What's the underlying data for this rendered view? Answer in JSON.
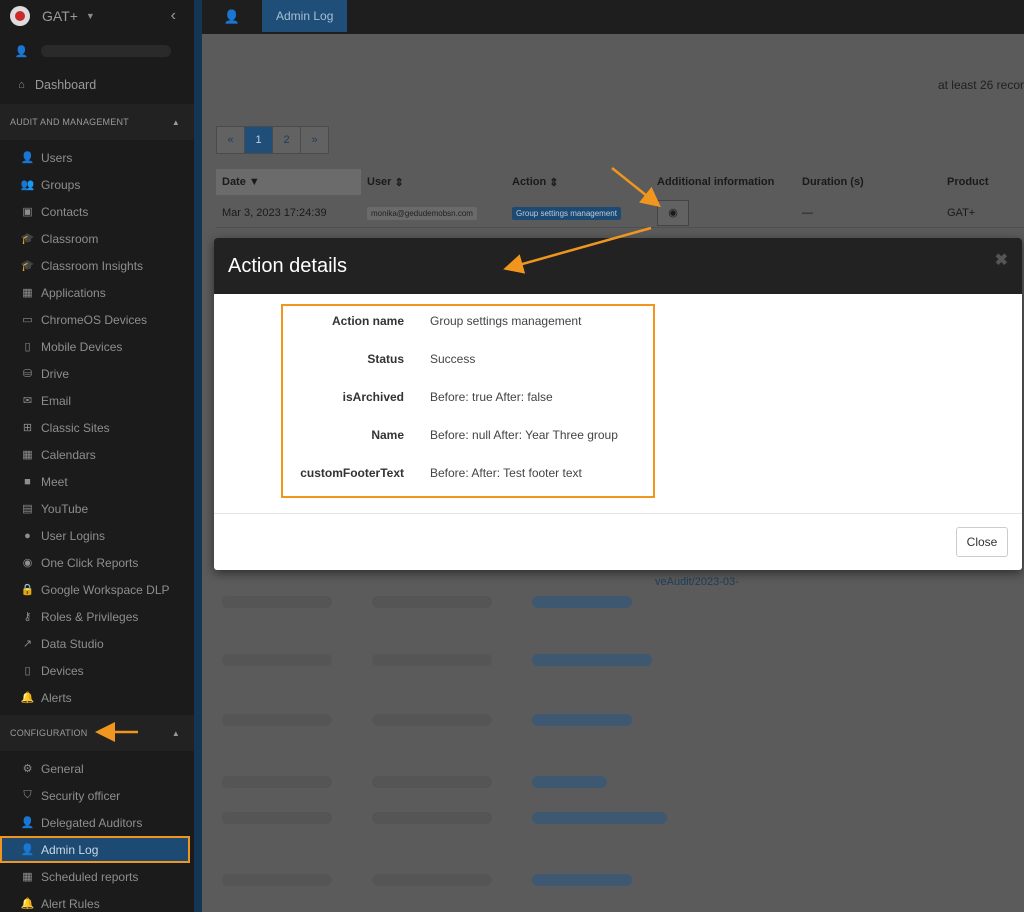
{
  "app": {
    "brand": "GAT+"
  },
  "sidebar": {
    "dashboard": "Dashboard",
    "section_audit": "AUDIT AND MANAGEMENT",
    "audit_items": [
      {
        "label": "Users",
        "icon": "user-icon",
        "glyph": "👤"
      },
      {
        "label": "Groups",
        "icon": "groups-icon",
        "glyph": "👥"
      },
      {
        "label": "Contacts",
        "icon": "contacts-icon",
        "glyph": "▣"
      },
      {
        "label": "Classroom",
        "icon": "classroom-icon",
        "glyph": "🎓"
      },
      {
        "label": "Classroom Insights",
        "icon": "classroom-insights-icon",
        "glyph": "🎓"
      },
      {
        "label": "Applications",
        "icon": "applications-icon",
        "glyph": "▦"
      },
      {
        "label": "ChromeOS Devices",
        "icon": "laptop-icon",
        "glyph": "▭"
      },
      {
        "label": "Mobile Devices",
        "icon": "mobile-icon",
        "glyph": "▯"
      },
      {
        "label": "Drive",
        "icon": "drive-icon",
        "glyph": "⛁"
      },
      {
        "label": "Email",
        "icon": "email-icon",
        "glyph": "✉"
      },
      {
        "label": "Classic Sites",
        "icon": "sitemap-icon",
        "glyph": "⊞"
      },
      {
        "label": "Calendars",
        "icon": "calendar-icon",
        "glyph": "▦"
      },
      {
        "label": "Meet",
        "icon": "video-icon",
        "glyph": "■"
      },
      {
        "label": "YouTube",
        "icon": "film-icon",
        "glyph": "▤"
      },
      {
        "label": "User Logins",
        "icon": "globe-icon",
        "glyph": "●"
      },
      {
        "label": "One Click Reports",
        "icon": "eye-icon",
        "glyph": "◉"
      },
      {
        "label": "Google Workspace DLP",
        "icon": "lock-icon",
        "glyph": "🔒"
      },
      {
        "label": "Roles & Privileges",
        "icon": "key-icon",
        "glyph": "⚷"
      },
      {
        "label": "Data Studio",
        "icon": "line-chart-icon",
        "glyph": "↗"
      },
      {
        "label": "Devices",
        "icon": "devices-icon",
        "glyph": "▯"
      },
      {
        "label": "Alerts",
        "icon": "bell-icon",
        "glyph": "🔔"
      }
    ],
    "section_config": "CONFIGURATION",
    "config_items": [
      {
        "label": "General",
        "icon": "gears-icon",
        "glyph": "⚙"
      },
      {
        "label": "Security officer",
        "icon": "shield-icon",
        "glyph": "⛉"
      },
      {
        "label": "Delegated Auditors",
        "icon": "user-share-icon",
        "glyph": "👤"
      },
      {
        "label": "Admin Log",
        "icon": "user-star-icon",
        "glyph": "👤",
        "active": true
      },
      {
        "label": "Scheduled reports",
        "icon": "calendar-icon",
        "glyph": "▦"
      },
      {
        "label": "Alert Rules",
        "icon": "bell-icon",
        "glyph": "🔔"
      }
    ]
  },
  "topbar": {
    "tab": "Admin Log"
  },
  "main": {
    "records": "at least 26 recor",
    "pager": [
      "«",
      "1",
      "2",
      "»"
    ],
    "pager_active": "1",
    "columns": [
      "Date",
      "User",
      "Action",
      "Additional information",
      "Duration (s)",
      "Product"
    ],
    "sort_indicators": {
      "date": "▼",
      "user": "⇕",
      "action": "⇕"
    },
    "row": {
      "date": "Mar 3, 2023 17:24:39",
      "user": "monika@gedudemobsn.com",
      "action": "Group settings management",
      "duration": "—",
      "product": "GAT+"
    },
    "partial_link": "veAudit/2023-03-"
  },
  "modal": {
    "title": "Action details",
    "close_x": "✖",
    "details": [
      {
        "label": "Action name",
        "value": "Group settings management"
      },
      {
        "label": "Status",
        "value": "Success"
      },
      {
        "label": "isArchived",
        "value": "Before: true After: false"
      },
      {
        "label": "Name",
        "value": "Before: null After: Year Three group"
      },
      {
        "label": "customFooterText",
        "value": "Before: After: Test footer text"
      }
    ],
    "close_button": "Close"
  },
  "colors": {
    "accent": "#f0961e",
    "primary": "#1d4a73",
    "modal_header": "#222222"
  }
}
